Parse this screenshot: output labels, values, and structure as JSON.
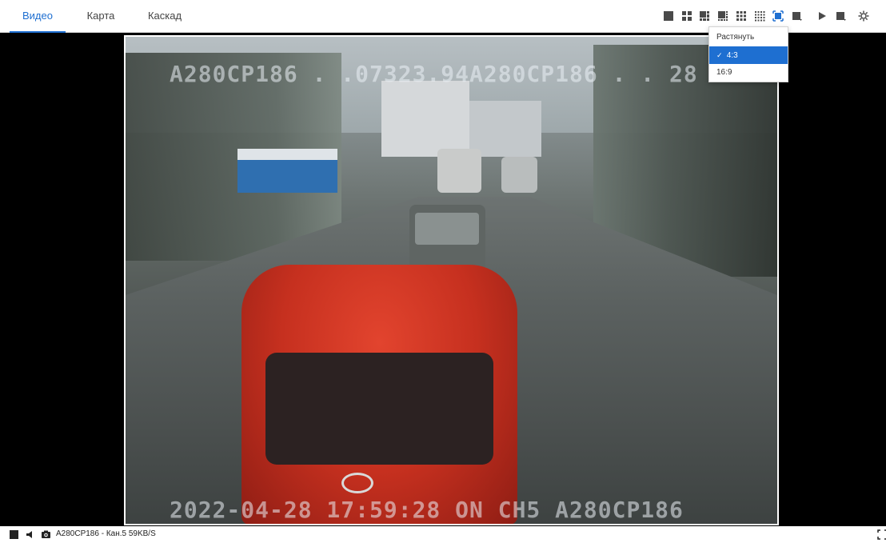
{
  "tabs": {
    "video": "Видео",
    "map": "Карта",
    "cascade": "Каскад"
  },
  "toolbar": {
    "icons": [
      "layout-1-icon",
      "layout-4-icon",
      "layout-6-icon",
      "layout-8-icon",
      "layout-9-icon",
      "layout-16-icon",
      "aspect-ratio-icon",
      "layout-dropdown-icon",
      "play-icon",
      "window-dropdown-icon",
      "settings-icon"
    ]
  },
  "aspect_menu": {
    "items": [
      {
        "label": "Растянуть",
        "selected": false
      },
      {
        "label": "4:3",
        "selected": true
      },
      {
        "label": "16:9",
        "selected": false
      }
    ],
    "check_mark": "✓"
  },
  "video": {
    "osd_top": "A280CP186 . .07323.94A280CP186 . . 28",
    "osd_bottom": "2022-04-28 17:59:28 ON CH5 A280CP186"
  },
  "status": {
    "text": "A280CP186 - Кан.5 59KB/S"
  },
  "colors": {
    "accent": "#1e6fd1",
    "icon": "#4a4a4a",
    "video_bg": "#000000"
  }
}
